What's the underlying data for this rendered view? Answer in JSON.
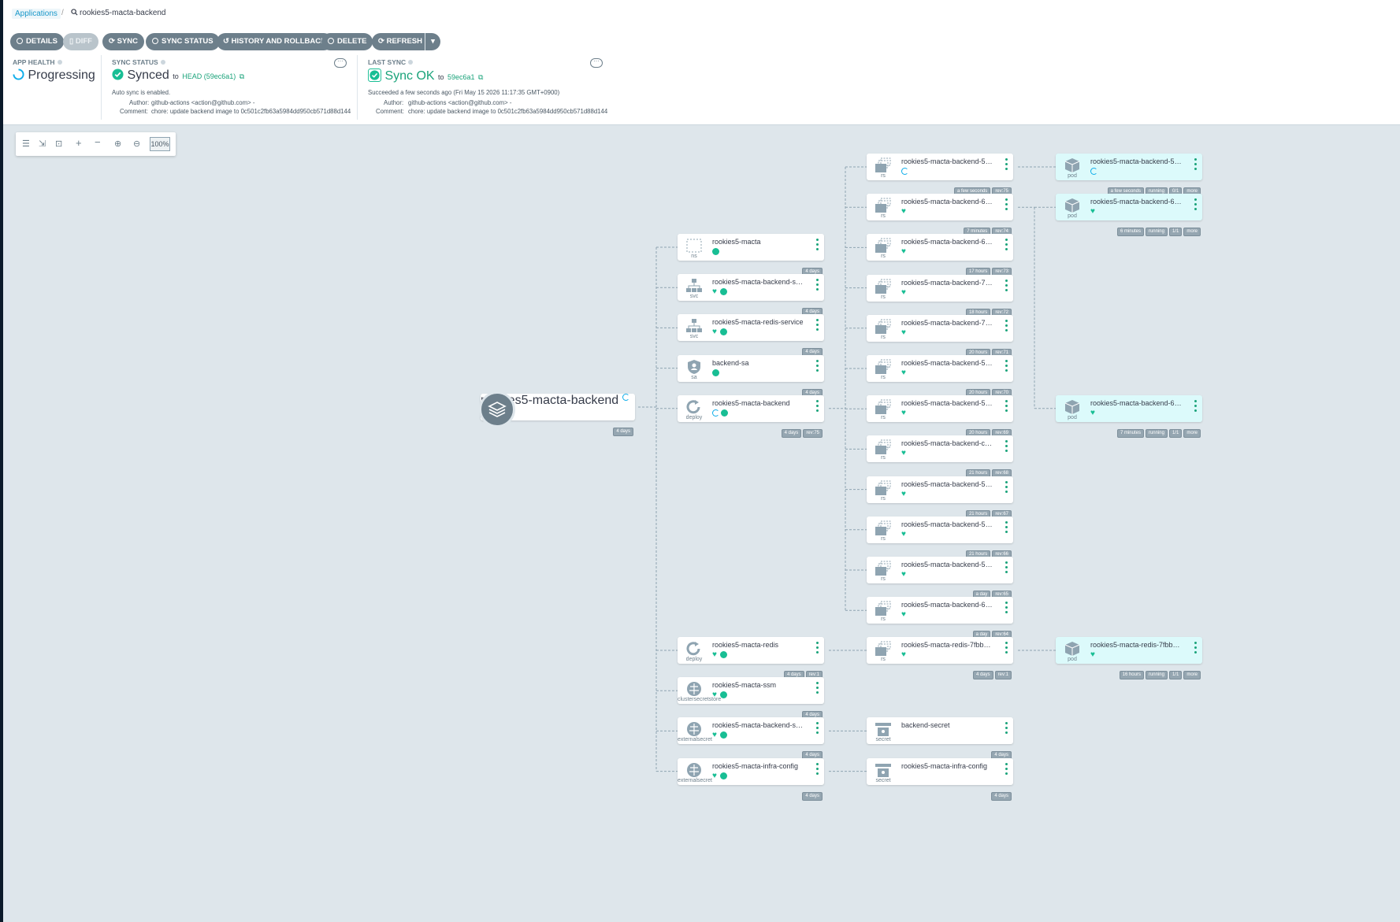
{
  "breadcrumb": {
    "apps_link": "Applications",
    "separator": "/",
    "current": "rookies5-macta-backend"
  },
  "toolbar": {
    "details": "DETAILS",
    "diff": "DIFF",
    "sync": "SYNC",
    "sync_status": "SYNC STATUS",
    "history": "HISTORY AND ROLLBACK",
    "delete": "DELETE",
    "refresh": "REFRESH"
  },
  "app_health": {
    "label": "APP HEALTH",
    "value": "Progressing"
  },
  "sync_status": {
    "label": "SYNC STATUS",
    "value": "Synced",
    "to": "to",
    "revision": "HEAD (59ec6a1)",
    "auto_sync": "Auto sync is enabled.",
    "author_label": "Author:",
    "author": "github-actions <action@github.com> -",
    "comment_label": "Comment:",
    "comment": "chore: update backend image to 0c501c2fb63a5984dd950cb571d88d144"
  },
  "last_sync": {
    "label": "LAST SYNC",
    "value": "Sync OK",
    "to": "to",
    "revision": "59ec6a1",
    "succeeded": "Succeeded a few seconds ago (Fri May 15 2026 11:17:35 GMT+0900)",
    "author_label": "Author:",
    "author": "github-actions <action@github.com> -",
    "comment_label": "Comment:",
    "comment": "chore: update backend image to 0c501c2fb63a5984dd950cb571d88d144"
  },
  "graph_tools": {
    "zoom": "100%"
  },
  "graph": {
    "app": {
      "name": "rookies5-macta-backend",
      "tags": [
        "4 days"
      ]
    },
    "level1": [
      {
        "kind": "ns",
        "name": "rookies5-macta",
        "status": [
          "check"
        ],
        "tags": [
          "4 days"
        ]
      },
      {
        "kind": "svc",
        "name": "rookies5-macta-backend-serv...",
        "status": [
          "heart",
          "check"
        ],
        "tags": [
          "4 days"
        ]
      },
      {
        "kind": "svc",
        "name": "rookies5-macta-redis-service",
        "status": [
          "heart",
          "check"
        ],
        "tags": [
          "4 days"
        ]
      },
      {
        "kind": "sa",
        "name": "backend-sa",
        "status": [
          "check"
        ],
        "tags": [
          "4 days"
        ]
      },
      {
        "kind": "deploy",
        "name": "rookies5-macta-backend",
        "status": [
          "progress",
          "check"
        ],
        "tags": [
          "4 days",
          "rev:75"
        ]
      },
      {
        "kind": "deploy",
        "name": "rookies5-macta-redis",
        "status": [
          "heart",
          "check"
        ],
        "tags": [
          "4 days",
          "rev:1"
        ]
      },
      {
        "kind": "clustersecretstore",
        "name": "rookies5-macta-ssm",
        "status": [
          "heart",
          "check"
        ],
        "tags": [
          "4 days"
        ]
      },
      {
        "kind": "externalsecret",
        "name": "rookies5-macta-backend-secr...",
        "status": [
          "heart",
          "check"
        ],
        "tags": [
          "4 days"
        ]
      },
      {
        "kind": "externalsecret",
        "name": "rookies5-macta-infra-config",
        "status": [
          "heart",
          "check"
        ],
        "tags": [
          "4 days"
        ]
      }
    ],
    "replicasets": [
      {
        "kind": "rs",
        "name": "rookies5-macta-backend-5bb...",
        "status": [
          "progress"
        ],
        "tags": [
          "a few seconds",
          "rev:75"
        ]
      },
      {
        "kind": "rs",
        "name": "rookies5-macta-backend-6fd...",
        "status": [
          "heart"
        ],
        "tags": [
          "7 minutes",
          "rev:74"
        ]
      },
      {
        "kind": "rs",
        "name": "rookies5-macta-backend-6bd...",
        "status": [
          "heart"
        ],
        "tags": [
          "17 hours",
          "rev:73"
        ]
      },
      {
        "kind": "rs",
        "name": "rookies5-macta-backend-764...",
        "status": [
          "heart"
        ],
        "tags": [
          "18 hours",
          "rev:72"
        ]
      },
      {
        "kind": "rs",
        "name": "rookies5-macta-backend-767...",
        "status": [
          "heart"
        ],
        "tags": [
          "20 hours",
          "rev:71"
        ]
      },
      {
        "kind": "rs",
        "name": "rookies5-macta-backend-576...",
        "status": [
          "heart"
        ],
        "tags": [
          "20 hours",
          "rev:70"
        ]
      },
      {
        "kind": "rs",
        "name": "rookies5-macta-backend-54b...",
        "status": [
          "heart"
        ],
        "tags": [
          "20 hours",
          "rev:69"
        ]
      },
      {
        "kind": "rs",
        "name": "rookies5-macta-backend-c7d...",
        "status": [
          "heart"
        ],
        "tags": [
          "21 hours",
          "rev:68"
        ]
      },
      {
        "kind": "rs",
        "name": "rookies5-macta-backend-5f9...",
        "status": [
          "heart"
        ],
        "tags": [
          "21 hours",
          "rev:67"
        ]
      },
      {
        "kind": "rs",
        "name": "rookies5-macta-backend-5bd...",
        "status": [
          "heart"
        ],
        "tags": [
          "21 hours",
          "rev:66"
        ]
      },
      {
        "kind": "rs",
        "name": "rookies5-macta-backend-588...",
        "status": [
          "heart"
        ],
        "tags": [
          "a day",
          "rev:65"
        ]
      },
      {
        "kind": "rs",
        "name": "rookies5-macta-backend-6c9...",
        "status": [
          "heart"
        ],
        "tags": [
          "a day",
          "rev:64"
        ]
      }
    ],
    "redis_rs": {
      "kind": "rs",
      "name": "rookies5-macta-redis-7fbb85f...",
      "status": [
        "heart"
      ],
      "tags": [
        "4 days",
        "rev:1"
      ]
    },
    "secrets": [
      {
        "kind": "secret",
        "name": "backend-secret",
        "status": [],
        "tags": [
          "4 days"
        ]
      },
      {
        "kind": "secret",
        "name": "rookies5-macta-infra-config",
        "status": [],
        "tags": [
          "4 days"
        ]
      }
    ],
    "pods": [
      {
        "kind": "pod",
        "name": "rookies5-macta-backend-5bb...",
        "status": [
          "progress"
        ],
        "tags": [
          "a few seconds",
          "running",
          "0/1",
          "more"
        ]
      },
      {
        "kind": "pod",
        "name": "rookies5-macta-backend-6fd...",
        "status": [
          "heart"
        ],
        "tags": [
          "6 minutes",
          "running",
          "1/1",
          "more"
        ]
      },
      {
        "kind": "pod",
        "name": "rookies5-macta-backend-6fd...",
        "status": [
          "heart"
        ],
        "tags": [
          "7 minutes",
          "running",
          "1/1",
          "more"
        ]
      },
      {
        "kind": "pod",
        "name": "rookies5-macta-redis-7fbb85f...",
        "status": [
          "heart"
        ],
        "tags": [
          "16 hours",
          "running",
          "1/1",
          "more"
        ]
      }
    ]
  },
  "colors": {
    "healthy": "#18be94",
    "progressing": "#0dadea",
    "link": "#1aa37a",
    "button": "#6d7f8b"
  }
}
